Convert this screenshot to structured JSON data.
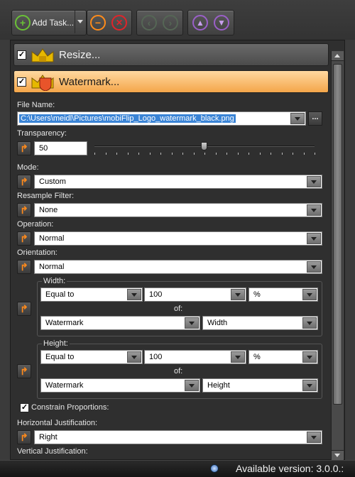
{
  "toolbar": {
    "add_task_label": "Add Task...",
    "buttons": [
      "add-icon",
      "dropdown-icon",
      "remove-icon",
      "delete-icon",
      "back-icon",
      "forward-icon",
      "move-up-icon",
      "move-down-icon"
    ]
  },
  "sections": {
    "resize": {
      "label": "Resize...",
      "checked": true
    },
    "watermark": {
      "label": "Watermark...",
      "checked": true
    }
  },
  "form": {
    "file_name_label": "File Name:",
    "file_name_value": "C:\\Users\\meidl\\Pictures\\mobiFlip_Logo_watermark_black.png",
    "browse_label": "...",
    "transparency_label": "Transparency:",
    "transparency_value": "50",
    "transparency_fraction": 0.5,
    "mode_label": "Mode:",
    "mode_value": "Custom",
    "resample_label": "Resample Filter:",
    "resample_value": "None",
    "operation_label": "Operation:",
    "operation_value": "Normal",
    "orientation_label": "Orientation:",
    "orientation_value": "Normal",
    "width_label": "Width:",
    "width_op": "Equal to",
    "width_value": "100",
    "width_unit": "%",
    "width_of_label": "of:",
    "width_of_source": "Watermark",
    "width_of_dim": "Width",
    "height_label": "Height:",
    "height_op": "Equal to",
    "height_value": "100",
    "height_unit": "%",
    "height_of_label": "of:",
    "height_of_source": "Watermark",
    "height_of_dim": "Height",
    "constrain_label": "Constrain Proportions:",
    "constrain_checked": true,
    "hjust_label": "Horizontal Justification:",
    "hjust_value": "Right",
    "vjust_label": "Vertical Justification:"
  },
  "status": {
    "available_version": "Available version: 3.0.0.:"
  }
}
